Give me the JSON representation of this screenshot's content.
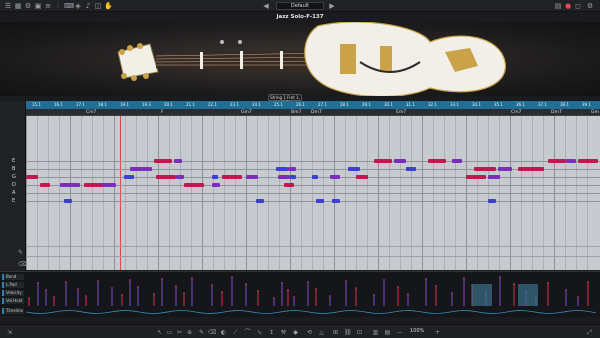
{
  "topbar": {
    "preset": "Default",
    "icons_left": [
      "menu-icon",
      "grid-icon",
      "settings-icon",
      "image-icon",
      "sliders-icon",
      "mixer-icon",
      "keyboard-icon",
      "tuner-icon",
      "note-icon",
      "pattern-icon",
      "hand-icon"
    ],
    "icons_right": [
      "save-icon",
      "record-icon",
      "window-icon",
      "gear-icon"
    ]
  },
  "instrument": {
    "title": "Jazz Solo-F-137",
    "tuning_label": "String 1 Fret 1, Off"
  },
  "ruler": {
    "bars": [
      "15.1",
      "16.1",
      "17.1",
      "18.1",
      "19.1",
      "19.3",
      "20.1",
      "21.1",
      "22.1",
      "23.1",
      "24.1",
      "25.1",
      "26.1",
      "27.1",
      "28.1",
      "29.1",
      "30.1",
      "31.1",
      "32.1",
      "33.1",
      "34.1",
      "35.1",
      "36.1",
      "37.1",
      "38.1",
      "39.1"
    ]
  },
  "chords": [
    "Cm7",
    "F",
    "Gm7",
    "Bm7",
    "Dm7",
    "Em7",
    "Cm7",
    "Dm7",
    "Gm"
  ],
  "strings": [
    "E",
    "B",
    "G",
    "D",
    "A",
    "E"
  ],
  "automation_lanes": [
    "Bend",
    "L.Pad",
    "Velocity",
    "Vol.Hold",
    "Timeline"
  ],
  "bottombar": {
    "zoom": "100%"
  },
  "colors": {
    "ruler": "#1f6f97",
    "note_red": "#c2184f",
    "note_purple": "#7a2dbf",
    "note_blue": "#3b3fd6",
    "playhead": "#e04a4a"
  }
}
